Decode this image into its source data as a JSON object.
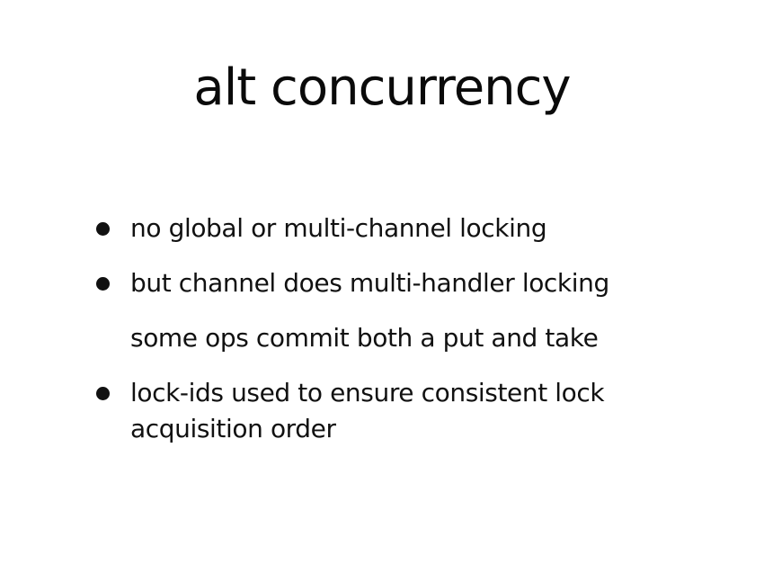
{
  "slide": {
    "title": "alt concurrency",
    "bullets": [
      {
        "text": "no global or multi-channel locking",
        "has_bullet": true
      },
      {
        "text": "but channel does multi-handler locking",
        "has_bullet": true
      },
      {
        "text": "some ops commit both a put and take",
        "has_bullet": false
      },
      {
        "text": "lock-ids used to ensure consistent lock acquisition order",
        "has_bullet": true
      }
    ]
  }
}
